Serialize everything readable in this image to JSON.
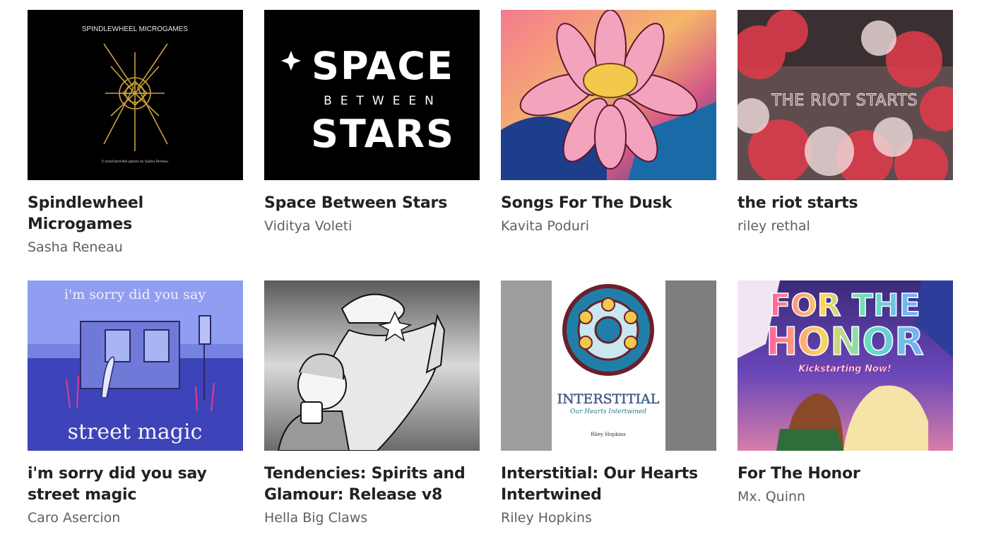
{
  "games": [
    {
      "title": "Spindlewheel Microgames",
      "author": "Sasha Reneau",
      "cover": {
        "heading": "SPINDLEWHEEL MICROGAMES",
        "tagline": "5 small tarot-like games by Sasha Reneau",
        "bg": "#000000",
        "accent": "#c9a23a"
      }
    },
    {
      "title": "Space Between Stars",
      "author": "Viditya Voleti",
      "cover": {
        "line1": "SPACE",
        "line2": "BETWEEN",
        "line3": "STARS",
        "bg": "#000000",
        "fg": "#ffffff"
      }
    },
    {
      "title": "Songs For The Dusk",
      "author": "Kavita Poduri",
      "cover": {
        "bg": "#d8567a",
        "petal": "#f4a3bd",
        "center": "#f2c94c",
        "accent": "#1e3d8a"
      }
    },
    {
      "title": "the riot starts",
      "author": "riley rethal",
      "cover": {
        "heading": "THE RIOT STARTS",
        "bg": "#6f5a59",
        "smoke": "#e33b4b"
      }
    },
    {
      "title": "i'm sorry did you say street magic",
      "author": "Caro Asercion",
      "cover": {
        "line1": "i'm sorry did you say",
        "line2": "street magic",
        "bg": "#5a5fcf",
        "sky": "#8f9ef0"
      }
    },
    {
      "title": "Tendencies: Spirits and Glamour: Release v8",
      "author": "Hella Big Claws",
      "cover": {
        "bg": "#8c8c8c"
      }
    },
    {
      "title": "Interstitial: Our Hearts Intertwined",
      "author": "Riley Hopkins",
      "cover": {
        "heading": "INTERSTITIAL",
        "subtitle": "Our Hearts Intertwined",
        "byline": "Riley Hopkins",
        "accent": "#1f7fa8"
      }
    },
    {
      "title": "For The Honor",
      "author": "Mx. Quinn",
      "cover": {
        "line1": "FOR THE",
        "line2": "HONOR",
        "banner": "Kickstarting Now!",
        "bg": "#5b3f9c"
      }
    }
  ]
}
